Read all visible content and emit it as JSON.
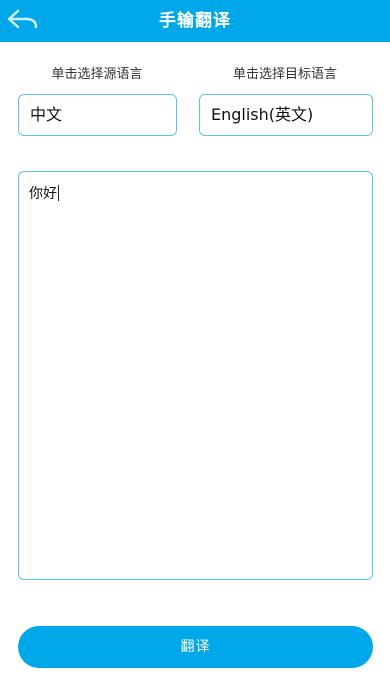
{
  "header": {
    "title": "手输翻译",
    "back_icon": "back-arrow-icon"
  },
  "source_language": {
    "label": "单击选择源语言",
    "value": "中文"
  },
  "target_language": {
    "label": "单击选择目标语言",
    "value": "English(英文)"
  },
  "input": {
    "text": "你好"
  },
  "translate_button": {
    "label": "翻译"
  },
  "colors": {
    "accent": "#00a8ea",
    "border": "#5cc6ea",
    "background": "#ffffff"
  }
}
